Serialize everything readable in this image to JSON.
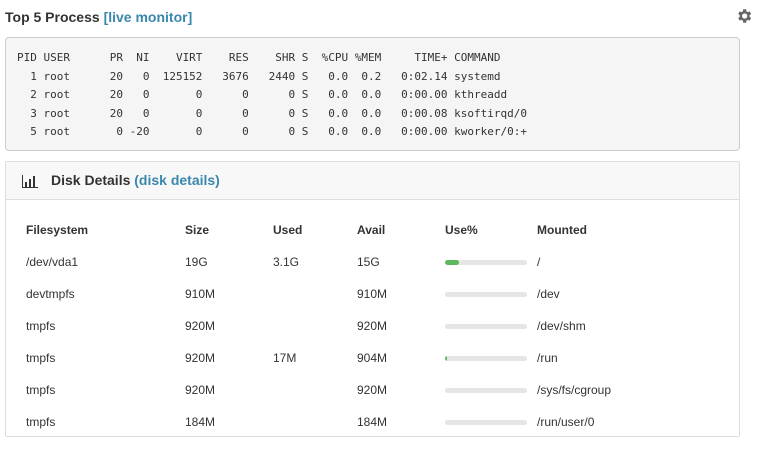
{
  "top_process": {
    "title": "Top 5 Process",
    "link": "[live monitor]",
    "lines": [
      "PID USER      PR  NI    VIRT    RES    SHR S  %CPU %MEM     TIME+ COMMAND",
      "  1 root      20   0  125152   3676   2440 S   0.0  0.2   0:02.14 systemd",
      "  2 root      20   0       0      0      0 S   0.0  0.0   0:00.00 kthreadd",
      "  3 root      20   0       0      0      0 S   0.0  0.0   0:00.08 ksoftirqd/0",
      "  5 root       0 -20       0      0      0 S   0.0  0.0   0:00.00 kworker/0:+"
    ]
  },
  "disk": {
    "title": "Disk Details",
    "link": "(disk details)",
    "headers": [
      "Filesystem",
      "Size",
      "Used",
      "Avail",
      "Use%",
      "Mounted"
    ],
    "rows": [
      {
        "filesystem": "/dev/vda1",
        "size": "19G",
        "used": "3.1G",
        "avail": "15G",
        "use_fraction": 0.17,
        "mounted": "/"
      },
      {
        "filesystem": "devtmpfs",
        "size": "910M",
        "used": "",
        "avail": "910M",
        "use_fraction": 0,
        "mounted": "/dev"
      },
      {
        "filesystem": "tmpfs",
        "size": "920M",
        "used": "",
        "avail": "920M",
        "use_fraction": 0,
        "mounted": "/dev/shm"
      },
      {
        "filesystem": "tmpfs",
        "size": "920M",
        "used": "17M",
        "avail": "904M",
        "use_fraction": 0.02,
        "mounted": "/run"
      },
      {
        "filesystem": "tmpfs",
        "size": "920M",
        "used": "",
        "avail": "920M",
        "use_fraction": 0,
        "mounted": "/sys/fs/cgroup"
      },
      {
        "filesystem": "tmpfs",
        "size": "184M",
        "used": "",
        "avail": "184M",
        "use_fraction": 0,
        "mounted": "/run/user/0"
      }
    ]
  },
  "colors": {
    "link": "#3a87ad",
    "bar_fill": "#5cb85c",
    "bar_track": "#e5e5e5"
  },
  "icons": {
    "settings": "gear-icon",
    "disk": "bar-chart-icon"
  }
}
